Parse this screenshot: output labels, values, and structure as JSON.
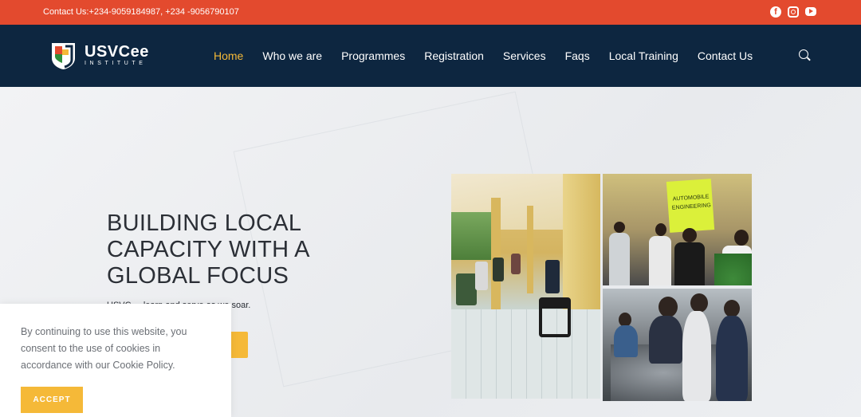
{
  "topbar": {
    "contact": "Contact Us:+234-9059184987, +234 -9056790107",
    "social_icons": [
      "facebook-icon",
      "instagram-icon",
      "youtube-icon"
    ],
    "color": "#e34a2e"
  },
  "header": {
    "logo_name": "USVCee",
    "logo_sub": "INSTITUTE",
    "background": "#0d2640",
    "nav": [
      {
        "label": "Home",
        "active": true
      },
      {
        "label": "Who we are",
        "active": false
      },
      {
        "label": "Programmes",
        "active": false
      },
      {
        "label": "Registration",
        "active": false
      },
      {
        "label": "Services",
        "active": false
      },
      {
        "label": "Faqs",
        "active": false
      },
      {
        "label": "Local Training",
        "active": false
      },
      {
        "label": "Contact Us",
        "active": false
      }
    ],
    "active_color": "#f5b938"
  },
  "hero": {
    "title_lines": [
      "BUILDING LOCAL",
      "CAPACITY WITH A",
      "GLOBAL FOCUS"
    ],
    "subtitle": "USVC ... learn and serve as we soar.",
    "button_color": "#f5b938",
    "photo_label": "AUTOMOBILE ENGINEERING"
  },
  "cookie": {
    "text": "By continuing to use this website, you consent to the use of cookies in accordance with our Cookie Policy.",
    "accept_label": "ACCEPT"
  }
}
